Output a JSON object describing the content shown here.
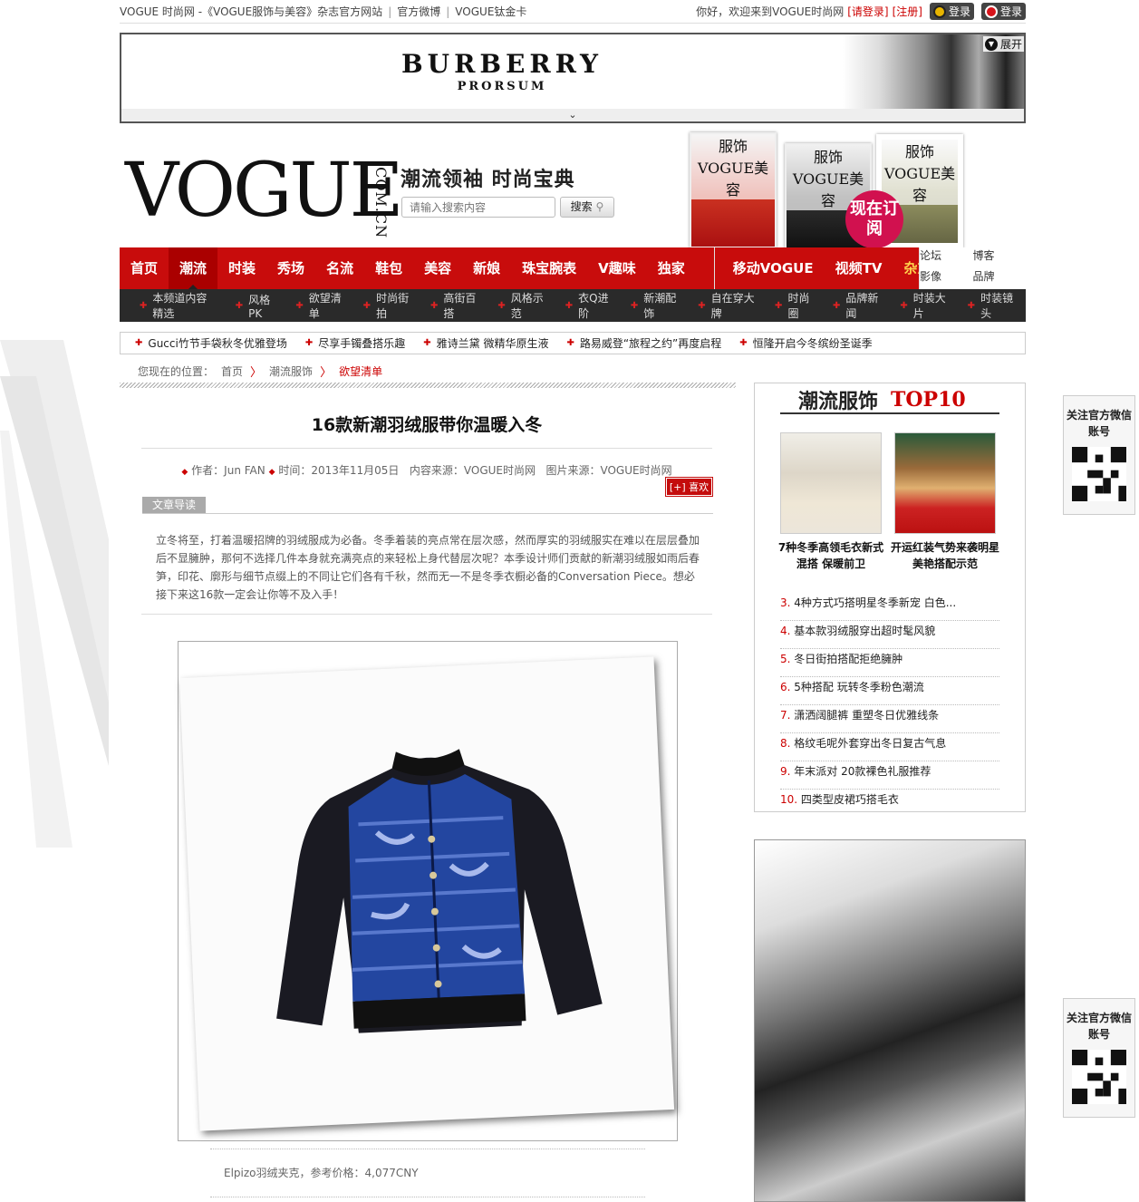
{
  "topbar": {
    "left": [
      "VOGUE 时尚网 -《VOGUE服饰与美容》杂志官方网站",
      "官方微博",
      "VOGUE钛金卡"
    ],
    "separator": "|",
    "welcome": "你好，欢迎来到VOGUE时尚网",
    "login": "[请登录]",
    "register": "[注册]",
    "qq_login": "登录",
    "weibo_login": "登录"
  },
  "ad_banner": {
    "brand": "BURBERRY",
    "sub": "PRORSUM",
    "expand": "展开",
    "collapse_arrow": "chevron-down-icon"
  },
  "header": {
    "logo": "VOGUE",
    "logo_suffix": ".COM.CN",
    "slogan": "潮流领袖  时尚宝典",
    "search_placeholder": "请输入搜索内容",
    "search_button": "搜索",
    "magazine_title": "服饰VOGUE美容",
    "magazine_badge": "现在订阅"
  },
  "nav": {
    "main": [
      "首页",
      "潮流",
      "时装",
      "秀场",
      "名流",
      "鞋包",
      "美容",
      "新娘",
      "珠宝腕表",
      "V趣味",
      "独家"
    ],
    "active": "潮流",
    "extra": [
      "移动VOGUE",
      "视频TV",
      "杂志"
    ],
    "right_links": [
      "论坛",
      "博客",
      "影像",
      "品牌"
    ],
    "sub": [
      "本频道内容精选",
      "风格PK",
      "欲望清单",
      "时尚街拍",
      "高街百搭",
      "风格示范",
      "衣Q进阶",
      "新潮配饰",
      "自在穿大牌",
      "时尚圈",
      "品牌新闻",
      "时装大片",
      "时装镜头"
    ],
    "hot": [
      "Gucci竹节手袋秋冬优雅登场",
      "尽享手镯叠搭乐趣",
      "雅诗兰黛 微精华原生液",
      "路易威登“旅程之约”再度启程",
      "恒隆开启今冬缤纷圣诞季"
    ]
  },
  "breadcrumb": {
    "label": "您现在的位置：",
    "items": [
      "首页",
      "潮流服饰",
      "欲望清单"
    ]
  },
  "article": {
    "title": "16款新潮羽绒服带你温暖入冬",
    "author_label": "作者：",
    "author": "Jun FAN",
    "time_label": "时间：",
    "time": "2013年11月05日",
    "source_label": "内容来源：",
    "source": "VOGUE时尚网",
    "pic_label": "图片来源：",
    "pic_source": "VOGUE时尚网",
    "like": "[+] 喜欢",
    "guide_label": "文章导读",
    "intro": "立冬将至，打着温暖招牌的羽绒服成为必备。冬季着装的亮点常在层次感，然而厚实的羽绒服实在难以在层层叠加后不显臃肿，那何不选择几件本身就充满亮点的来轻松上身代替层次呢？本季设计师们贡献的新潮羽绒服如雨后春笋，印花、廓形与细节点缀上的不同让它们各有千秋，然而无一不是冬季衣橱必备的Conversation Piece。想必接下来这16款一定会让你等不及入手！",
    "caption": "Elpizo羽绒夹克，参考价格：4,077CNY"
  },
  "sidebar": {
    "title_a": "潮流服饰",
    "title_b": "TOP10",
    "cards": [
      {
        "caption": "7种冬季高领毛衣新式混搭 保暖前卫"
      },
      {
        "caption": "开运红装气势来袭明星美艳搭配示范"
      }
    ],
    "ranks": [
      {
        "n": "3.",
        "t": "4种方式巧搭明星冬季新宠 白色..."
      },
      {
        "n": "4.",
        "t": "基本款羽绒服穿出超时髦风貌"
      },
      {
        "n": "5.",
        "t": "冬日街拍搭配拒绝臃肿"
      },
      {
        "n": "6.",
        "t": "5种搭配 玩转冬季粉色潮流"
      },
      {
        "n": "7.",
        "t": "潇洒阔腿裤 重塑冬日优雅线条"
      },
      {
        "n": "8.",
        "t": "格纹毛呢外套穿出冬日复古气息"
      },
      {
        "n": "9.",
        "t": "年末派对 20款裸色礼服推荐"
      },
      {
        "n": "10.",
        "t": "四类型皮裙巧搭毛衣"
      }
    ]
  },
  "floating": {
    "wechat": "关注官方微信账号"
  },
  "colors": {
    "accent": "#c80c0c",
    "subnav": "#2a2a2a",
    "link_red": "#cc0000"
  }
}
